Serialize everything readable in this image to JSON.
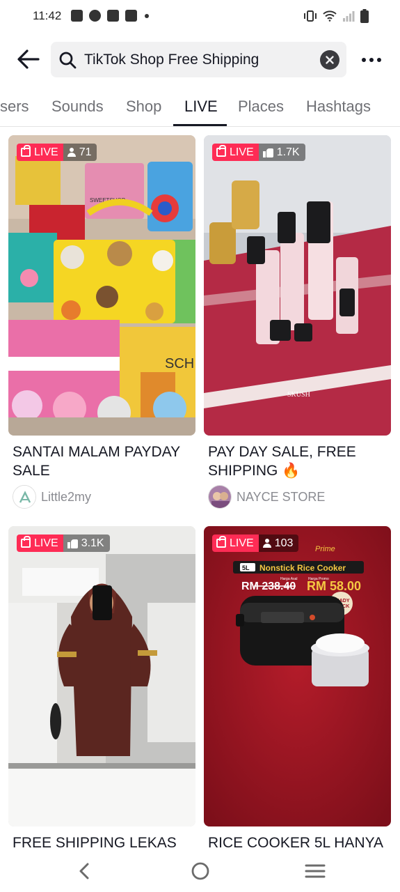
{
  "status_bar": {
    "time": "11:42"
  },
  "search": {
    "query": "TikTok Shop Free Shipping"
  },
  "tabs": [
    {
      "label": "sers"
    },
    {
      "label": "Sounds"
    },
    {
      "label": "Shop"
    },
    {
      "label": "LIVE"
    },
    {
      "label": "Places"
    },
    {
      "label": "Hashtags"
    }
  ],
  "active_tab": "LIVE",
  "live_label": "LIVE",
  "cards": [
    {
      "viewers": "71",
      "viewer_icon": "person-icon",
      "title": "SANTAI MALAM PAYDAY SALE",
      "author": "Little2my"
    },
    {
      "viewers": "1.7K",
      "viewer_icon": "like-icon",
      "title": "PAY DAY SALE, FREE SHIPPING 🔥",
      "author": "NAYCE STORE"
    },
    {
      "viewers": "3.1K",
      "viewer_icon": "like-icon",
      "title": "FREE SHIPPING LEKAS",
      "author": ""
    },
    {
      "viewers": "103",
      "viewer_icon": "person-icon",
      "title": "RICE COOKER 5L HANYA",
      "author": ""
    }
  ],
  "promo": {
    "brand": "Prime",
    "capacity": "5L",
    "product": "Nonstick Rice Cooker",
    "old_label": "Harga Asal",
    "promo_label": "Harga Promo",
    "old_price": "RM 238.40",
    "new_price": "RM 58.00",
    "stamp_line1": "READY",
    "stamp_line2": "STOCK"
  },
  "product_labels": {
    "sign": "SWEETSHOP",
    "school": "SCH",
    "perfume": "SKUSH"
  },
  "colors": {
    "accent": "#fe2c55",
    "text": "#161823",
    "muted": "#8a8b91"
  }
}
